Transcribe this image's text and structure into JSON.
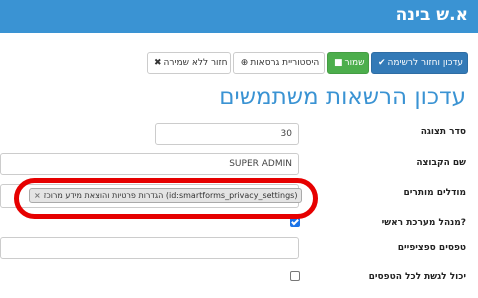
{
  "brand": "א.ש בינה",
  "toolbar": {
    "update_return_label": "עדכון וחזור לרשימה",
    "update_return_icon": "check-icon",
    "save_label": "שמור",
    "save_icon": "floppy-disk-icon",
    "history_label": "היסטוריית גרסאות",
    "history_icon": "history-icon",
    "back_nosave_label": "חזור ללא שמירה",
    "back_nosave_icon": "times-icon"
  },
  "page": {
    "title": "עדכון הרשאות משתמשים"
  },
  "form": {
    "display_order": {
      "label": "סדר תצוגה",
      "value": "30"
    },
    "group_name": {
      "label": "שם הקבוצה",
      "value": "SUPER ADMIN"
    },
    "allowed_modules": {
      "label": "מודלים מותרים",
      "tag_text": "הגדרות פרטיות והוצאת מידע מרוכז (id:smartforms_privacy_settings)",
      "tag_remove": "×"
    },
    "is_admin": {
      "label": "מנהל מערכת ראשי?",
      "checked": true
    },
    "specific_forms": {
      "label": "טפסים ספציפיים",
      "value": ""
    },
    "access_all_forms": {
      "label": "יכול לגשת לכל הטפסים",
      "checked": false
    }
  },
  "colors": {
    "topbar": "#3a93d3",
    "primary": "#337ab7",
    "success": "#4cae4c",
    "annotation": "#e60000"
  }
}
